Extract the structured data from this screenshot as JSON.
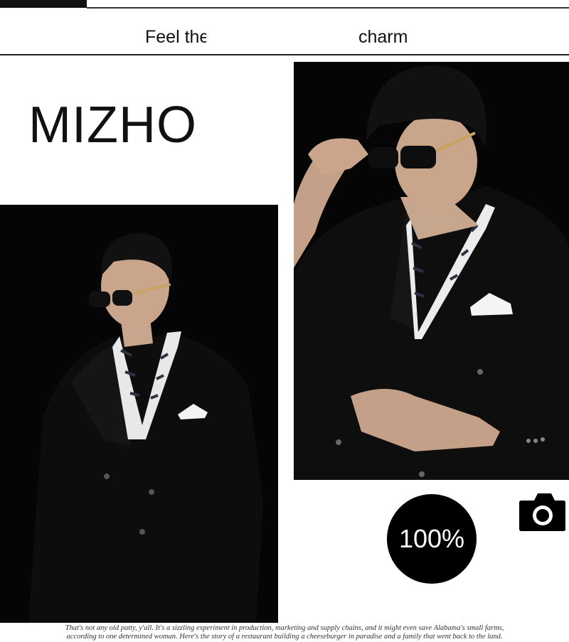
{
  "header": {
    "tagline_left": "Feel the",
    "tagline_right": "charm"
  },
  "brand": "MIZHO",
  "photos": [
    {
      "name": "model-seated-photo",
      "subject": "man in black double-breasted blazer, sunglasses, striped shirt, pocket square"
    },
    {
      "name": "model-adjusting-sunglasses-photo",
      "subject": "man adjusting sunglasses, black blazer, striped shirt, pocket square"
    }
  ],
  "badge": {
    "label": "100%"
  },
  "icons": {
    "camera": "camera-icon"
  },
  "footer": {
    "line1": "That's not any old patty, y'all. It's a sizzling experiment in production, marketing and supply chains, and it might even save Alabama's small farms,",
    "line2": "according to one determined woman. Here's the story of a restaurant building a cheeseburger in paradise and a family that went back to the land."
  },
  "colors": {
    "background": "#ffffff",
    "photo_bg": "#050505",
    "text": "#111111",
    "badge_bg": "#000000"
  }
}
